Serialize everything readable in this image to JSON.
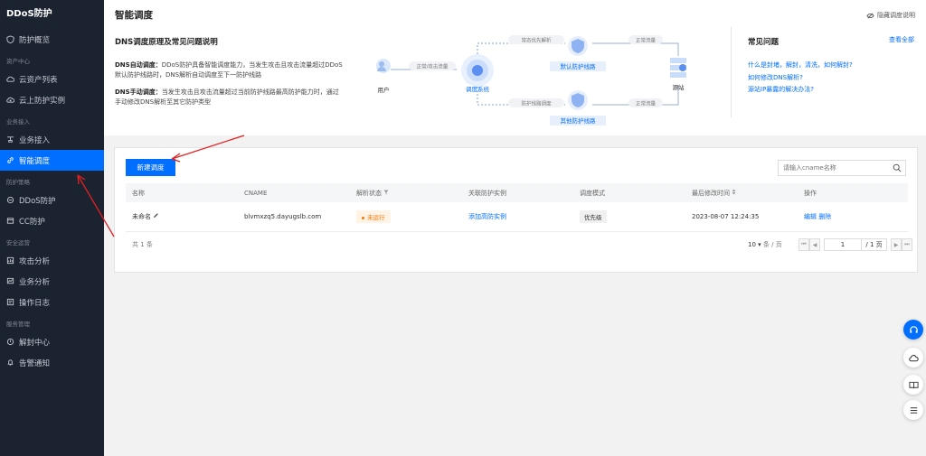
{
  "sidebar": {
    "brand": "DDoS防护",
    "items_top": [
      {
        "label": "防护概览",
        "icon": "shield-icon"
      }
    ],
    "group_asset": "资产中心",
    "items_asset": [
      {
        "label": "云资产列表",
        "icon": "cloud-icon"
      },
      {
        "label": "云上防护实例",
        "icon": "cloud-shield-icon"
      }
    ],
    "group_access": "业务接入",
    "items_access": [
      {
        "label": "业务接入",
        "icon": "plug-icon"
      },
      {
        "label": "智能调度",
        "icon": "link-icon",
        "active": true
      }
    ],
    "group_policy": "防护策略",
    "items_policy": [
      {
        "label": "DDoS防护",
        "icon": "ddos-icon"
      },
      {
        "label": "CC防护",
        "icon": "cc-icon"
      }
    ],
    "group_ops": "安全运营",
    "items_ops": [
      {
        "label": "攻击分析",
        "icon": "attack-chart-icon"
      },
      {
        "label": "业务分析",
        "icon": "business-chart-icon"
      },
      {
        "label": "操作日志",
        "icon": "log-icon"
      }
    ],
    "group_service": "服务管理",
    "items_service": [
      {
        "label": "解封中心",
        "icon": "unlock-icon"
      },
      {
        "label": "告警通知",
        "icon": "bell-icon"
      }
    ]
  },
  "top": {
    "title": "智能调度",
    "hide_guide": "隐藏调度说明",
    "section_title": "DNS调度原理及常见问题说明",
    "auto_label": "DNS自动调度：",
    "auto_text": "DDoS防护具备智能调度能力，当发生攻击且攻击流量超过DDoS默认防护线路时，DNS解析自动调度至下一防护线路",
    "manual_label": "DNS手动调度：",
    "manual_text": "当发生攻击且攻击流量超过当前防护线路最高防护能力时，通过手动修改DNS解析至其它防护类型",
    "diagram": {
      "user": "用户",
      "scheduler": "调度系统",
      "default_line": "默认防护线路",
      "other_line": "其他防护线路",
      "origin": "源站",
      "tag_normal_attack": "正常/攻击流量",
      "tag_normal_resolve": "常态优先解析",
      "tag_normal_flow_top": "正常流量",
      "tag_line_schedule": "防护线路调度",
      "tag_normal_flow_bottom": "正常流量"
    },
    "faq": {
      "title": "常见问题",
      "view_all": "查看全部",
      "links": [
        "什么是封堵，解封，清洗，如何解封?",
        "如何修改DNS解析?",
        "源站IP暴露的解决办法?"
      ]
    }
  },
  "card": {
    "new_button": "新建调度",
    "search_placeholder": "请输入cname名称",
    "columns": [
      "名称",
      "CNAME",
      "解析状态",
      "关联防护实例",
      "调度模式",
      "最后修改时间",
      "操作"
    ],
    "rows": [
      {
        "name": "未命名",
        "cname": "blvmxzq5.dayugslb.com",
        "status": "未运行",
        "instance": "添加高防实例",
        "mode": "优先级",
        "modified": "2023-08-07 12:24:35",
        "edit": "编辑",
        "delete": "删除"
      }
    ],
    "total": "共 1 条",
    "page_size": "10",
    "page_size_unit": "条 / 页",
    "page": "1",
    "page_total": "/ 1 页"
  },
  "colors": {
    "primary": "#006eff",
    "sidebar_bg": "#1c2330",
    "annotation": "#e02020",
    "status_off": "#ff7200"
  }
}
